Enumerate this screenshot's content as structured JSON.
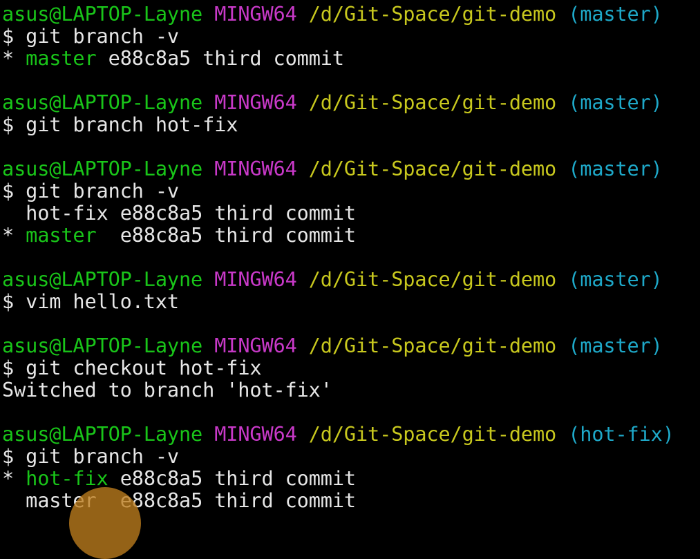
{
  "terminal": {
    "lines": [
      {
        "kind": "prompt",
        "user": "asus@LAPTOP-Layne",
        "system": "MINGW64",
        "path": "/d/Git-Space/git-demo",
        "branch": "(master)"
      },
      {
        "kind": "command",
        "dollar": "$",
        "command": "git branch -v"
      },
      {
        "kind": "branch",
        "marker": "*",
        "name": "master",
        "pad": "",
        "detail": "e88c8a5 third commit",
        "current": true
      },
      {
        "kind": "blank"
      },
      {
        "kind": "prompt",
        "user": "asus@LAPTOP-Layne",
        "system": "MINGW64",
        "path": "/d/Git-Space/git-demo",
        "branch": "(master)"
      },
      {
        "kind": "command",
        "dollar": "$",
        "command": "git branch hot-fix"
      },
      {
        "kind": "blank"
      },
      {
        "kind": "prompt",
        "user": "asus@LAPTOP-Layne",
        "system": "MINGW64",
        "path": "/d/Git-Space/git-demo",
        "branch": "(master)"
      },
      {
        "kind": "command",
        "dollar": "$",
        "command": "git branch -v"
      },
      {
        "kind": "branch",
        "marker": " ",
        "name": "hot-fix",
        "pad": "",
        "detail": "e88c8a5 third commit",
        "current": false
      },
      {
        "kind": "branch",
        "marker": "*",
        "name": "master",
        "pad": " ",
        "detail": "e88c8a5 third commit",
        "current": true
      },
      {
        "kind": "blank"
      },
      {
        "kind": "prompt",
        "user": "asus@LAPTOP-Layne",
        "system": "MINGW64",
        "path": "/d/Git-Space/git-demo",
        "branch": "(master)"
      },
      {
        "kind": "command",
        "dollar": "$",
        "command": "vim hello.txt"
      },
      {
        "kind": "blank"
      },
      {
        "kind": "prompt",
        "user": "asus@LAPTOP-Layne",
        "system": "MINGW64",
        "path": "/d/Git-Space/git-demo",
        "branch": "(master)"
      },
      {
        "kind": "command",
        "dollar": "$",
        "command": "git checkout hot-fix"
      },
      {
        "kind": "output",
        "text": "Switched to branch 'hot-fix'"
      },
      {
        "kind": "blank"
      },
      {
        "kind": "prompt",
        "user": "asus@LAPTOP-Layne",
        "system": "MINGW64",
        "path": "/d/Git-Space/git-demo",
        "branch": "(hot-fix)"
      },
      {
        "kind": "command",
        "dollar": "$",
        "command": "git branch -v"
      },
      {
        "kind": "branch",
        "marker": "*",
        "name": "hot-fix",
        "pad": "",
        "detail": "e88c8a5 third commit",
        "current": true
      },
      {
        "kind": "branch",
        "marker": " ",
        "name": "master",
        "pad": " ",
        "detail": "e88c8a5 third commit",
        "current": false
      }
    ]
  },
  "colors": {
    "background": "#000000",
    "user_host": "#19c519",
    "system_name": "#c839c8",
    "path": "#c8c81e",
    "git_branch": "#1ea8c8",
    "current_branch": "#19c519",
    "default_text": "#e6e6e6",
    "cursor_highlight": "#be7d1e"
  }
}
